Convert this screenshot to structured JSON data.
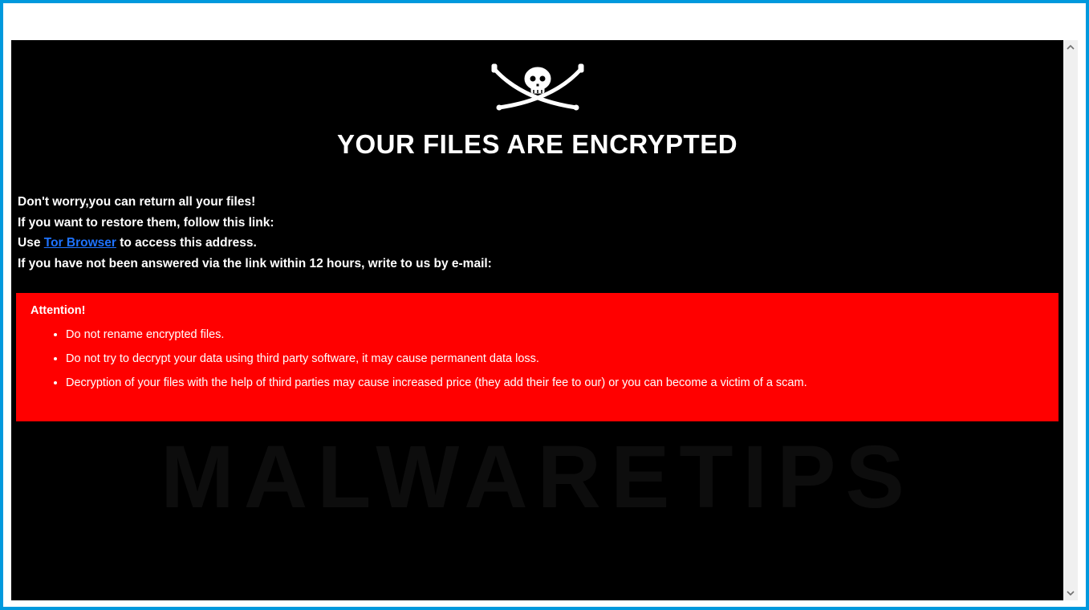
{
  "title": "YOUR FILES ARE ENCRYPTED",
  "lines": {
    "l1": "Don't worry,you can return all your files!",
    "l2": "If you want to restore them, follow this link:",
    "l3a": "Use ",
    "l3_link": "Tor Browser",
    "l3b": " to access this address.",
    "l4": "If you have not been answered via the link within 12 hours, write to us by e-mail:"
  },
  "attention": {
    "heading": "Attention!",
    "items": [
      "Do not rename encrypted files.",
      "Do not try to decrypt your data using third party software, it may cause permanent data loss.",
      "Decryption of your files with the help of third parties may cause increased price (they add their fee to our) or you can become a victim of a scam."
    ]
  },
  "watermark": "MALWARETIPS"
}
